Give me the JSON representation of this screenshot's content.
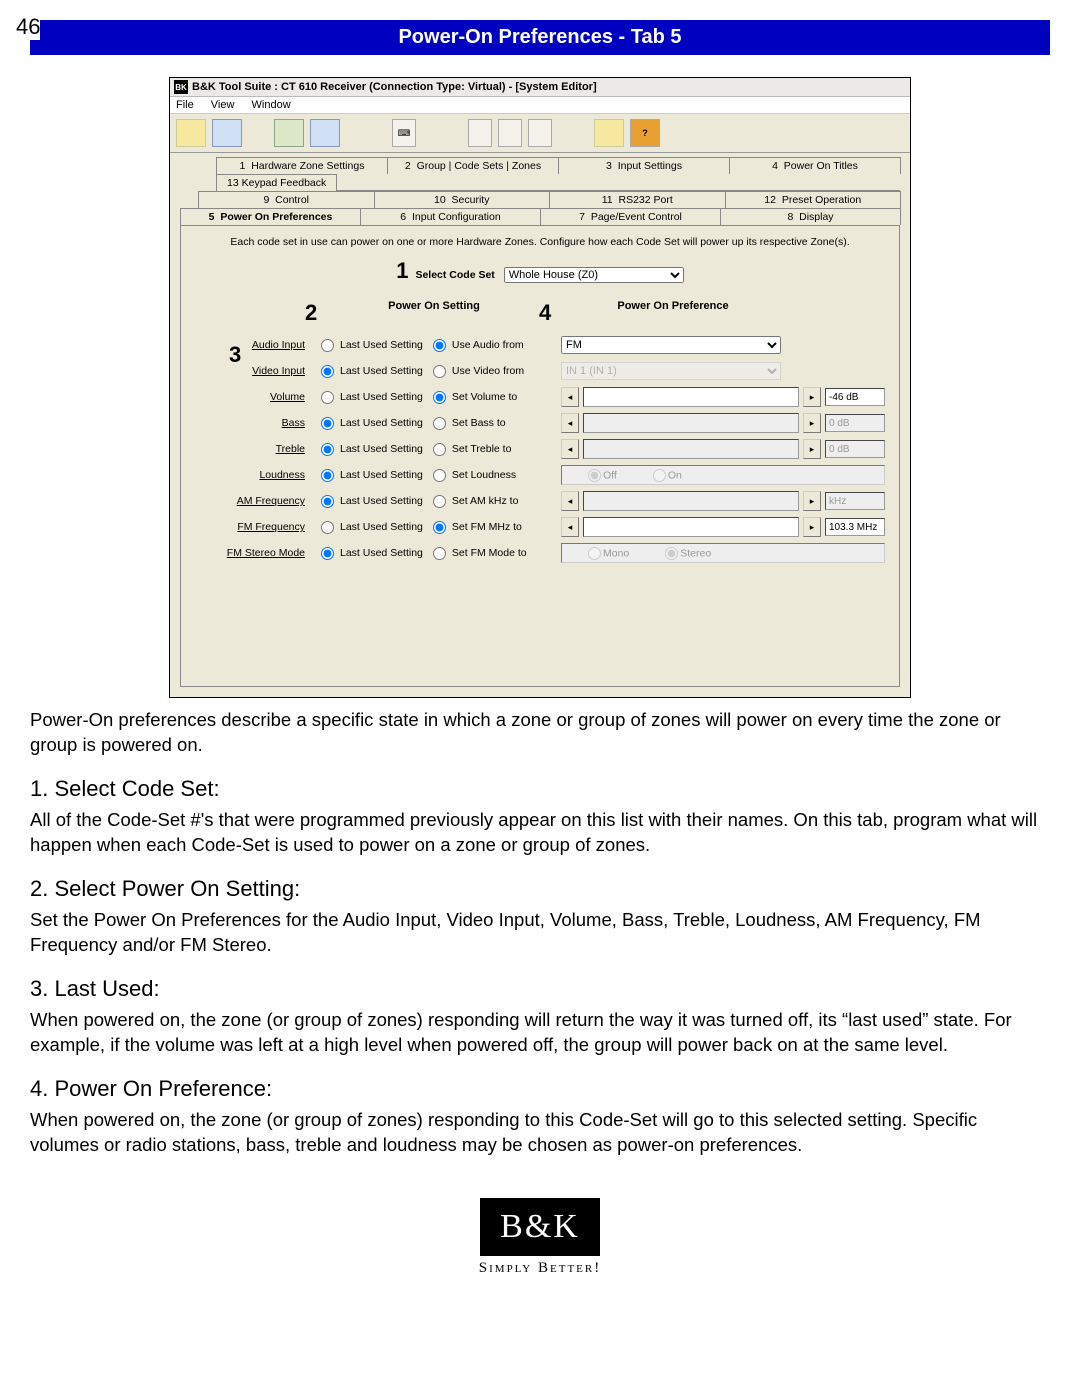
{
  "page_number": "46",
  "banner_title": "Power-On Preferences - Tab 5",
  "window": {
    "title": "B&K Tool Suite : CT 610 Receiver (Connection Type: Virtual) - [System Editor]",
    "menus": [
      "File",
      "View",
      "Window"
    ]
  },
  "tabs": {
    "row1": [
      {
        "n": "1",
        "label": "Hardware Zone Settings"
      },
      {
        "n": "2",
        "label": "Group | Code Sets | Zones"
      },
      {
        "n": "3",
        "label": "Input Settings"
      },
      {
        "n": "4",
        "label": "Power On Titles"
      }
    ],
    "row2": [
      {
        "n": "13",
        "label": "Keypad Feedback"
      }
    ],
    "row3": [
      {
        "n": "9",
        "label": "Control"
      },
      {
        "n": "10",
        "label": "Security"
      },
      {
        "n": "11",
        "label": "RS232 Port"
      },
      {
        "n": "12",
        "label": "Preset Operation"
      }
    ],
    "row4": [
      {
        "n": "5",
        "label": "Power On Preferences",
        "active": true
      },
      {
        "n": "6",
        "label": "Input Configuration"
      },
      {
        "n": "7",
        "label": "Page/Event Control"
      },
      {
        "n": "8",
        "label": "Display"
      }
    ]
  },
  "panel": {
    "help_line": "Each code set in use can power on one or more Hardware Zones. Configure how each Code Set will power up its respective Zone(s).",
    "code_set_label": "Select Code Set",
    "code_set_value": "Whole House (Z0)",
    "header_setting": "Power On Setting",
    "header_pref": "Power On Preference",
    "rows": [
      {
        "name": "Audio Input",
        "opt2": "Use Audio from",
        "sel": 2,
        "pref_type": "select",
        "pref_value": "FM"
      },
      {
        "name": "Video Input",
        "opt2": "Use Video from",
        "sel": 1,
        "pref_type": "select",
        "pref_value": "IN 1 (IN 1)",
        "disabled": true
      },
      {
        "name": "Volume",
        "opt2": "Set Volume to",
        "sel": 2,
        "pref_type": "slider",
        "pref_value": "-46 dB"
      },
      {
        "name": "Bass",
        "opt2": "Set Bass to",
        "sel": 1,
        "pref_type": "slider",
        "pref_value": "0 dB",
        "disabled": true
      },
      {
        "name": "Treble",
        "opt2": "Set Treble to",
        "sel": 1,
        "pref_type": "slider",
        "pref_value": "0 dB",
        "disabled": true
      },
      {
        "name": "Loudness",
        "opt2": "Set Loudness",
        "sel": 1,
        "pref_type": "radio",
        "opt_a": "Off",
        "opt_b": "On",
        "disabled": true
      },
      {
        "name": "AM Frequency",
        "opt2": "Set AM kHz to",
        "sel": 1,
        "pref_type": "slider",
        "pref_value": "kHz",
        "disabled": true
      },
      {
        "name": "FM Frequency",
        "opt2": "Set FM MHz to",
        "sel": 2,
        "pref_type": "slider",
        "pref_value": "103.3 MHz"
      },
      {
        "name": "FM Stereo Mode",
        "opt2": "Set FM Mode to",
        "sel": 1,
        "pref_type": "radio",
        "opt_a": "Mono",
        "opt_b": "Stereo",
        "opt_sel": "b",
        "disabled": true
      }
    ]
  },
  "callouts": {
    "c1": "1",
    "c2": "2",
    "c3": "3",
    "c4": "4"
  },
  "intro_text": "Power-On preferences describe a specific state in which a zone or group of zones will power on every time the zone or group is powered on.",
  "sections": [
    {
      "head": "1. Select Code Set:",
      "body": "All of the Code-Set #'s that were programmed previously appear on this list with their names. On this tab, program what will happen when each Code-Set is used to power on a zone or group of zones."
    },
    {
      "head": "2. Select Power On Setting:",
      "body": "Set the Power On Preferences for the Audio Input, Video Input, Volume, Bass, Treble, Loudness, AM Frequency, FM Frequency and/or  FM Stereo."
    },
    {
      "head": "3. Last Used:",
      "body": "When powered on, the zone (or group of zones) responding will return the way it was turned off, its “last used” state.  For example, if the volume was left at a high level when powered off, the group will power back on at the same level."
    },
    {
      "head": "4. Power On Preference:",
      "body": "When powered on, the zone (or group of zones) responding to this Code-Set will go to this selected setting. Specific volumes or radio stations, bass, treble and loudness may be chosen as power-on preferences."
    }
  ],
  "logo": {
    "text": "B&K",
    "tag": "Simply Better!"
  }
}
